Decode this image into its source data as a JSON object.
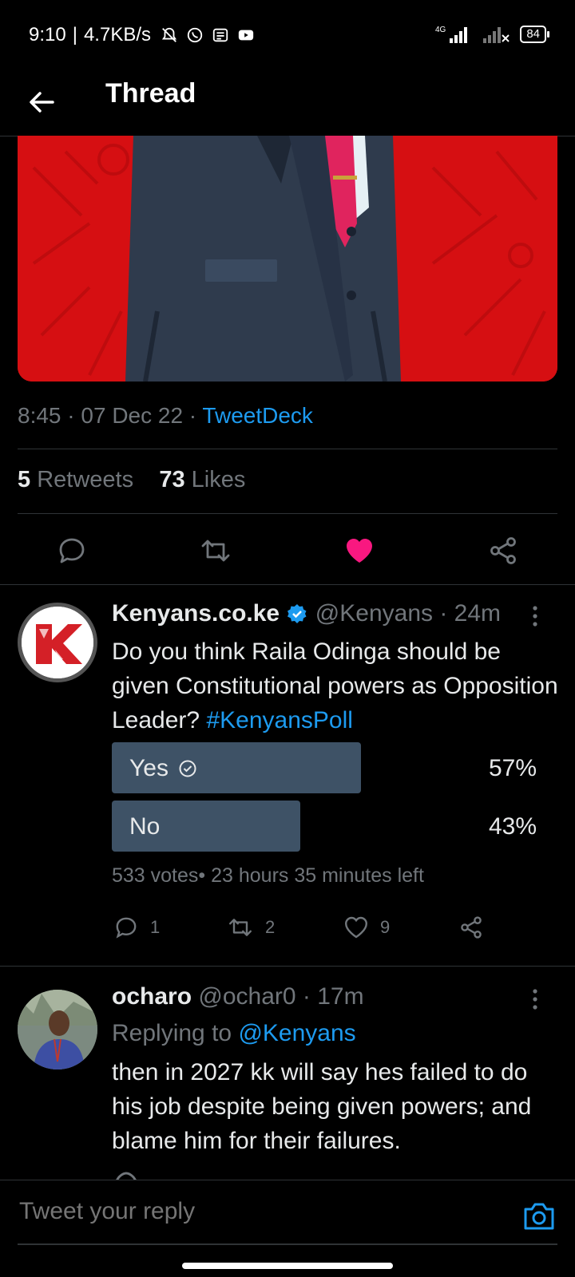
{
  "status_bar": {
    "time": "9:10",
    "speed": "4.7KB/s",
    "network": "4G",
    "battery": "84"
  },
  "header": {
    "title": "Thread"
  },
  "tweet_meta": {
    "time": "8:45",
    "date": "07 Dec 22",
    "client": "TweetDeck"
  },
  "stats": {
    "retweets_count": "5",
    "retweets_label": "Retweets",
    "likes_count": "73",
    "likes_label": "Likes"
  },
  "colors": {
    "accent": "#1d9bf0",
    "like": "#f91880",
    "poll_bar": "#3e5266",
    "media_bg": "#d60f12"
  },
  "quote_tweet": {
    "name": "Kenyans.co.ke",
    "handle": "@Kenyans",
    "age": "· 24m",
    "text": "Do you think Raila Odinga should be given Constitutional powers as Opposition Leader?",
    "hashtag": "#KenyansPoll",
    "poll": {
      "options": [
        {
          "label": "Yes",
          "percent": "57%",
          "fraction": 0.57,
          "winner": true
        },
        {
          "label": "No",
          "percent": "43%",
          "fraction": 0.43,
          "winner": false
        }
      ],
      "info": "533 votes• 23 hours 35 minutes left"
    },
    "replies": "1",
    "retweets": "2",
    "likes": "9"
  },
  "reply_tweet": {
    "name": "ocharo",
    "handle": "@ochar0",
    "age": "· 17m",
    "replying_prefix": "Replying to",
    "replying_to": "@Kenyans",
    "text": "then in 2027 kk will say hes failed to do his job despite being given powers; and blame him for their failures."
  },
  "composer": {
    "placeholder": "Tweet your reply"
  }
}
